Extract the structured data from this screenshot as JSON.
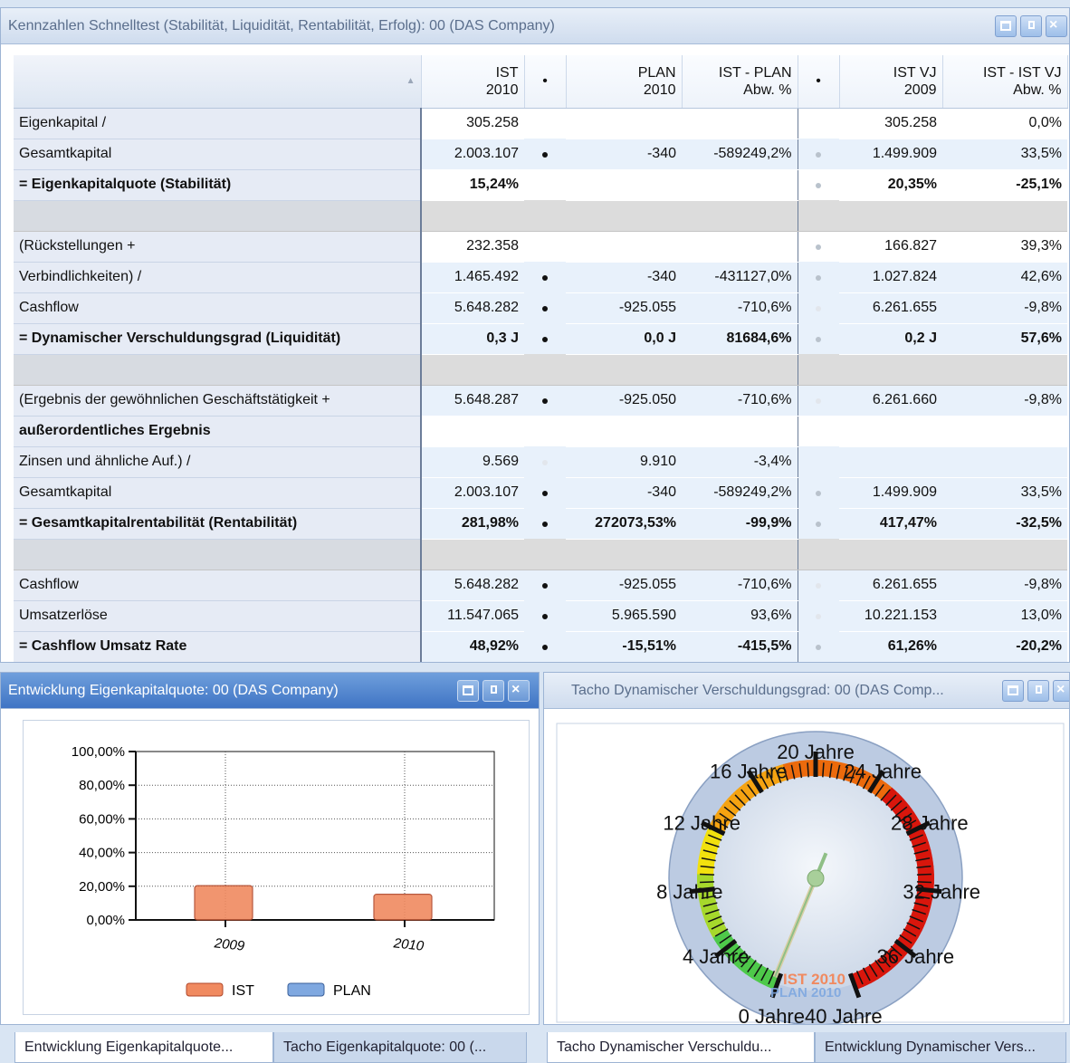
{
  "top_panel": {
    "title": "Kennzahlen Schnelltest (Stabilität, Liquidität, Rentabilität, Erfolg): 00 (DAS Company)",
    "columns": [
      {
        "line1": "IST",
        "line2": "2010"
      },
      {
        "line1": "•",
        "line2": ""
      },
      {
        "line1": "PLAN",
        "line2": "2010"
      },
      {
        "line1": "IST - PLAN",
        "line2": "Abw. %"
      },
      {
        "line1": "•",
        "line2": ""
      },
      {
        "line1": "IST VJ",
        "line2": "2009"
      },
      {
        "line1": "IST - IST VJ",
        "line2": "Abw. %"
      }
    ],
    "rows": [
      {
        "label": "Eigenkapital /",
        "ist": "305.258",
        "d1": "",
        "plan": "",
        "abw": "",
        "d2": "",
        "vj": "305.258",
        "abwvj": "0,0%"
      },
      {
        "label": "Gesamtkapital",
        "ist": "2.003.107",
        "d1": "black",
        "plan": "-340",
        "abw": "-589249,2%",
        "d2": "grey",
        "vj": "1.499.909",
        "abwvj": "33,5%"
      },
      {
        "label": "= Eigenkapitalquote (Stabilität)",
        "ist": "15,24%",
        "d1": "",
        "plan": "",
        "abw": "",
        "d2": "grey",
        "vj": "20,35%",
        "abwvj": "-25,1%"
      },
      {
        "label": "",
        "ist": "",
        "d1": "",
        "plan": "",
        "abw": "",
        "d2": "",
        "vj": "",
        "abwvj": ""
      },
      {
        "label": "(Rückstellungen +",
        "ist": "232.358",
        "d1": "",
        "plan": "",
        "abw": "",
        "d2": "grey",
        "vj": "166.827",
        "abwvj": "39,3%"
      },
      {
        "label": "Verbindlichkeiten) /",
        "ist": "1.465.492",
        "d1": "black",
        "plan": "-340",
        "abw": "-431127,0%",
        "d2": "grey",
        "vj": "1.027.824",
        "abwvj": "42,6%"
      },
      {
        "label": "Cashflow",
        "ist": "5.648.282",
        "d1": "black",
        "plan": "-925.055",
        "abw": "-710,6%",
        "d2": "light",
        "vj": "6.261.655",
        "abwvj": "-9,8%"
      },
      {
        "label": "= Dynamischer Verschuldungsgrad (Liquidität)",
        "ist": "0,3 J",
        "d1": "black",
        "plan": "0,0 J",
        "abw": "81684,6%",
        "d2": "grey",
        "vj": "0,2 J",
        "abwvj": "57,6%"
      },
      {
        "label": "",
        "ist": "",
        "d1": "",
        "plan": "",
        "abw": "",
        "d2": "",
        "vj": "",
        "abwvj": ""
      },
      {
        "label": "(Ergebnis der gewöhnlichen Geschäftstätigkeit +",
        "ist": "5.648.287",
        "d1": "black",
        "plan": "-925.050",
        "abw": "-710,6%",
        "d2": "light",
        "vj": "6.261.660",
        "abwvj": "-9,8%"
      },
      {
        "label": "außerordentliches Ergebnis",
        "ist": "",
        "d1": "",
        "plan": "",
        "abw": "",
        "d2": "",
        "vj": "",
        "abwvj": ""
      },
      {
        "label": "Zinsen und ähnliche Auf.) /",
        "ist": "9.569",
        "d1": "light",
        "plan": "9.910",
        "abw": "-3,4%",
        "d2": "",
        "vj": "",
        "abwvj": ""
      },
      {
        "label": "Gesamtkapital",
        "ist": "2.003.107",
        "d1": "black",
        "plan": "-340",
        "abw": "-589249,2%",
        "d2": "grey",
        "vj": "1.499.909",
        "abwvj": "33,5%"
      },
      {
        "label": "= Gesamtkapitalrentabilität (Rentabilität)",
        "ist": "281,98%",
        "d1": "black",
        "plan": "272073,53%",
        "abw": "-99,9%",
        "d2": "grey",
        "vj": "417,47%",
        "abwvj": "-32,5%"
      },
      {
        "label": "",
        "ist": "",
        "d1": "",
        "plan": "",
        "abw": "",
        "d2": "",
        "vj": "",
        "abwvj": ""
      },
      {
        "label": "Cashflow",
        "ist": "5.648.282",
        "d1": "black",
        "plan": "-925.055",
        "abw": "-710,6%",
        "d2": "light",
        "vj": "6.261.655",
        "abwvj": "-9,8%"
      },
      {
        "label": "Umsatzerlöse",
        "ist": "11.547.065",
        "d1": "black",
        "plan": "5.965.590",
        "abw": "93,6%",
        "d2": "light",
        "vj": "10.221.153",
        "abwvj": "13,0%"
      },
      {
        "label": "= Cashflow Umsatz Rate",
        "ist": "48,92%",
        "d1": "black",
        "plan": "-15,51%",
        "abw": "-415,5%",
        "d2": "grey",
        "vj": "61,26%",
        "abwvj": "-20,2%"
      }
    ]
  },
  "left_panel": {
    "title": "Entwicklung Eigenkapitalquote: 00 (DAS Company)",
    "tabs": [
      "Entwicklung Eigenkapitalquote...",
      "Tacho Eigenkapitalquote: 00 (..."
    ],
    "chart_data": {
      "type": "bar",
      "categories": [
        "2009",
        "2010"
      ],
      "series": [
        {
          "name": "IST",
          "values": [
            20.35,
            15.24
          ],
          "color": "#f08a60"
        },
        {
          "name": "PLAN",
          "values": [
            null,
            null
          ],
          "color": "#7fa8e0"
        }
      ],
      "yticks": [
        "100,00%",
        "80,00%",
        "60,00%",
        "40,00%",
        "20,00%",
        "0,00%"
      ],
      "ylim": [
        0,
        100
      ],
      "grid": true,
      "legend": "bottom"
    }
  },
  "right_panel": {
    "title": "Tacho Dynamischer Verschuldungsgrad: 00 (DAS Comp...",
    "tabs": [
      "Tacho Dynamischer Verschuldu...",
      "Entwicklung Dynamischer Vers..."
    ],
    "gauge": {
      "labels": [
        "0 Jahre",
        "4 Jahre",
        "8 Jahre",
        "12 Jahre",
        "16 Jahre",
        "20 Jahre",
        "24 Jahre",
        "28 Jahre",
        "32 Jahre",
        "36 Jahre",
        "40 Jahre"
      ],
      "min": 0,
      "max": 40,
      "needle_value": 0.3,
      "marker_ist": "IST 2010",
      "marker_plan": "PLAN 2010",
      "ist_color": "#f08a60",
      "plan_color": "#7fa8e0"
    }
  }
}
